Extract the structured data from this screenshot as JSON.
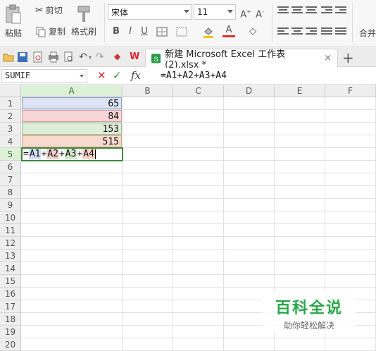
{
  "ribbon": {
    "paste_label": "粘贴",
    "cut_label": "剪切",
    "copy_label": "复制",
    "format_painter_label": "格式刷",
    "font_name": "宋体",
    "font_size": "11",
    "merge_label": "合并"
  },
  "tabbar": {
    "doc_title": "新建 Microsoft Excel 工作表 (2).xlsx *",
    "close_glyph": "×",
    "new_tab_glyph": "+"
  },
  "formula_bar": {
    "name_box": "SUMIF",
    "cancel_glyph": "✕",
    "confirm_glyph": "✓",
    "fx_label": "fx",
    "formula": "=A1+A2+A3+A4"
  },
  "sheet": {
    "columns": [
      "A",
      "B",
      "C",
      "D",
      "E",
      "F"
    ],
    "rows": [
      "1",
      "2",
      "3",
      "4",
      "5",
      "6",
      "7",
      "8",
      "9",
      "10",
      "11",
      "12",
      "13",
      "14",
      "15",
      "16",
      "17",
      "18",
      "19",
      "20"
    ],
    "cells": {
      "A1": "65",
      "A2": "84",
      "A3": "153",
      "A4": "515"
    },
    "editing_cell": {
      "eq": "=",
      "ref1": "A1",
      "op1": "+",
      "ref2": "A2",
      "op2": "+",
      "ref3": "A3",
      "op3": "+",
      "ref4": "A4"
    }
  },
  "watermark": {
    "title": "百科全说",
    "subtitle": "助你轻松解决"
  },
  "colors": {
    "accent_green": "#3f8a3f",
    "ref_blue": "#dde3f5",
    "ref_red": "#f6d6d6",
    "ref_green": "#e0edda",
    "ref_orange": "#f8d9cd"
  }
}
